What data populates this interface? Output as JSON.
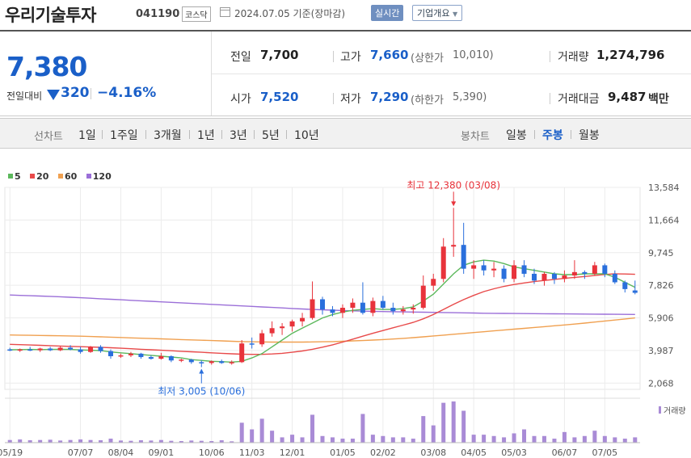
{
  "header": {
    "stock_name": "우리기술투자",
    "stock_code": "041190",
    "market": "코스닥",
    "date": "2024.07.05",
    "date_suffix": "기준(장마감)",
    "realtime_label": "실시간",
    "company_label": "기업개요"
  },
  "quote": {
    "current_price": "7,380",
    "change_label": "전일대비",
    "change_direction": "down",
    "change_value": "320",
    "change_pct": "−4.16%",
    "prev_close_label": "전일",
    "prev_close": "7,700",
    "high_label": "고가",
    "high": "7,660",
    "upper_limit_label": "(상한가",
    "upper_limit": "10,010)",
    "volume_label": "거래량",
    "volume": "1,274,796",
    "open_label": "시가",
    "open": "7,520",
    "low_label": "저가",
    "low": "7,290",
    "lower_limit_label": "(하한가",
    "lower_limit": "5,390)",
    "amount_label": "거래대금",
    "amount": "9,487",
    "amount_unit": "백만"
  },
  "period": {
    "line_label": "선차트",
    "line_items": [
      "1일",
      "1주일",
      "3개월",
      "1년",
      "3년",
      "5년",
      "10년"
    ],
    "candle_label": "봉차트",
    "candle_items": [
      "일봉",
      "주봉",
      "월봉"
    ],
    "active_candle": "주봉"
  },
  "chart_data": {
    "type": "candlestick",
    "interval": "weekly",
    "legend": [
      {
        "name": "5",
        "color": "#5cb85c"
      },
      {
        "name": "20",
        "color": "#e84a4a"
      },
      {
        "name": "60",
        "color": "#f0a050"
      },
      {
        "name": "120",
        "color": "#9b6fd8"
      }
    ],
    "y_ticks": [
      2068,
      3987,
      5906,
      7826,
      9745,
      11664,
      13584
    ],
    "y_tick_labels": [
      "2,068",
      "3,987",
      "5,906",
      "7,826",
      "9,745",
      "11,664",
      "13,584"
    ],
    "ylim": [
      1700,
      13584
    ],
    "x_labels": [
      {
        "label": "05/19",
        "index": 0
      },
      {
        "label": "07/07",
        "index": 7
      },
      {
        "label": "08/04",
        "index": 11
      },
      {
        "label": "09/01",
        "index": 15
      },
      {
        "label": "10/06",
        "index": 20
      },
      {
        "label": "11/03",
        "index": 24
      },
      {
        "label": "12/01",
        "index": 28
      },
      {
        "label": "01/05",
        "index": 33
      },
      {
        "label": "02/02",
        "index": 37
      },
      {
        "label": "03/08",
        "index": 42
      },
      {
        "label": "04/05",
        "index": 46
      },
      {
        "label": "05/03",
        "index": 50
      },
      {
        "label": "06/07",
        "index": 55
      },
      {
        "label": "07/05",
        "index": 59
      }
    ],
    "candles": [
      {
        "o": 4050,
        "h": 4150,
        "l": 3950,
        "c": 4000
      },
      {
        "o": 4000,
        "h": 4100,
        "l": 3900,
        "c": 4050
      },
      {
        "o": 4050,
        "h": 4200,
        "l": 3950,
        "c": 4000
      },
      {
        "o": 4000,
        "h": 4150,
        "l": 3900,
        "c": 4100
      },
      {
        "o": 4100,
        "h": 4200,
        "l": 3950,
        "c": 4000
      },
      {
        "o": 4000,
        "h": 4250,
        "l": 3950,
        "c": 4150
      },
      {
        "o": 4150,
        "h": 4300,
        "l": 4000,
        "c": 4050
      },
      {
        "o": 4050,
        "h": 4200,
        "l": 3800,
        "c": 3900
      },
      {
        "o": 3900,
        "h": 4250,
        "l": 3850,
        "c": 4200
      },
      {
        "o": 4200,
        "h": 4300,
        "l": 3850,
        "c": 3950
      },
      {
        "o": 3950,
        "h": 4050,
        "l": 3500,
        "c": 3650
      },
      {
        "o": 3650,
        "h": 3800,
        "l": 3550,
        "c": 3700
      },
      {
        "o": 3700,
        "h": 3900,
        "l": 3600,
        "c": 3800
      },
      {
        "o": 3800,
        "h": 3850,
        "l": 3500,
        "c": 3600
      },
      {
        "o": 3600,
        "h": 3700,
        "l": 3450,
        "c": 3500
      },
      {
        "o": 3500,
        "h": 3850,
        "l": 3450,
        "c": 3650
      },
      {
        "o": 3650,
        "h": 3700,
        "l": 3300,
        "c": 3400
      },
      {
        "o": 3400,
        "h": 3500,
        "l": 3300,
        "c": 3450
      },
      {
        "o": 3450,
        "h": 3500,
        "l": 3200,
        "c": 3300
      },
      {
        "o": 3300,
        "h": 3400,
        "l": 3005,
        "c": 3250
      },
      {
        "o": 3250,
        "h": 3400,
        "l": 3150,
        "c": 3350
      },
      {
        "o": 3350,
        "h": 3450,
        "l": 3200,
        "c": 3250
      },
      {
        "o": 3250,
        "h": 3400,
        "l": 3150,
        "c": 3300
      },
      {
        "o": 3300,
        "h": 4600,
        "l": 3250,
        "c": 4400
      },
      {
        "o": 4400,
        "h": 4750,
        "l": 4100,
        "c": 4350
      },
      {
        "o": 4350,
        "h": 5200,
        "l": 4200,
        "c": 5000
      },
      {
        "o": 5000,
        "h": 5700,
        "l": 4800,
        "c": 5300
      },
      {
        "o": 5300,
        "h": 5600,
        "l": 4900,
        "c": 5400
      },
      {
        "o": 5400,
        "h": 5800,
        "l": 5100,
        "c": 5700
      },
      {
        "o": 5700,
        "h": 6200,
        "l": 5400,
        "c": 5900
      },
      {
        "o": 5900,
        "h": 8050,
        "l": 5800,
        "c": 7000
      },
      {
        "o": 7000,
        "h": 7150,
        "l": 6100,
        "c": 6400
      },
      {
        "o": 6400,
        "h": 6600,
        "l": 6000,
        "c": 6200
      },
      {
        "o": 6200,
        "h": 6700,
        "l": 5900,
        "c": 6500
      },
      {
        "o": 6500,
        "h": 7050,
        "l": 6200,
        "c": 6800
      },
      {
        "o": 6800,
        "h": 8000,
        "l": 6100,
        "c": 6200
      },
      {
        "o": 6200,
        "h": 7100,
        "l": 6000,
        "c": 6900
      },
      {
        "o": 6900,
        "h": 7200,
        "l": 6400,
        "c": 6500
      },
      {
        "o": 6500,
        "h": 6800,
        "l": 6100,
        "c": 6300
      },
      {
        "o": 6300,
        "h": 6600,
        "l": 6100,
        "c": 6400
      },
      {
        "o": 6400,
        "h": 6700,
        "l": 6150,
        "c": 6500
      },
      {
        "o": 6500,
        "h": 8400,
        "l": 6400,
        "c": 7800
      },
      {
        "o": 7800,
        "h": 8500,
        "l": 7500,
        "c": 8200
      },
      {
        "o": 8200,
        "h": 10600,
        "l": 8000,
        "c": 10100
      },
      {
        "o": 10100,
        "h": 12380,
        "l": 9500,
        "c": 10200
      },
      {
        "o": 10200,
        "h": 11500,
        "l": 8500,
        "c": 8800
      },
      {
        "o": 8800,
        "h": 9300,
        "l": 8200,
        "c": 9000
      },
      {
        "o": 9000,
        "h": 9300,
        "l": 8400,
        "c": 8700
      },
      {
        "o": 8700,
        "h": 9200,
        "l": 8300,
        "c": 8800
      },
      {
        "o": 8800,
        "h": 9000,
        "l": 8000,
        "c": 8200
      },
      {
        "o": 8200,
        "h": 9300,
        "l": 8000,
        "c": 9000
      },
      {
        "o": 9000,
        "h": 9300,
        "l": 8300,
        "c": 8500
      },
      {
        "o": 8500,
        "h": 8800,
        "l": 7900,
        "c": 8100
      },
      {
        "o": 8100,
        "h": 8600,
        "l": 7800,
        "c": 8500
      },
      {
        "o": 8500,
        "h": 8600,
        "l": 7900,
        "c": 8200
      },
      {
        "o": 8200,
        "h": 8700,
        "l": 8000,
        "c": 8400
      },
      {
        "o": 8400,
        "h": 9300,
        "l": 8200,
        "c": 8600
      },
      {
        "o": 8600,
        "h": 8700,
        "l": 8200,
        "c": 8500
      },
      {
        "o": 8500,
        "h": 9200,
        "l": 8400,
        "c": 9000
      },
      {
        "o": 9000,
        "h": 9100,
        "l": 8300,
        "c": 8500
      },
      {
        "o": 8500,
        "h": 8700,
        "l": 7900,
        "c": 8000
      },
      {
        "o": 8000,
        "h": 8100,
        "l": 7400,
        "c": 7600
      },
      {
        "o": 7520,
        "h": 8100,
        "l": 7290,
        "c": 7380
      }
    ],
    "ma5": [
      4030,
      4040,
      4050,
      4040,
      4050,
      4060,
      4050,
      4020,
      4000,
      3980,
      3900,
      3850,
      3800,
      3750,
      3700,
      3650,
      3600,
      3550,
      3450,
      3400,
      3350,
      3330,
      3300,
      3350,
      3550,
      3800,
      4200,
      4600,
      5000,
      5300,
      5600,
      5900,
      6100,
      6250,
      6350,
      6400,
      6450,
      6400,
      6400,
      6450,
      6550,
      6900,
      7300,
      7900,
      8500,
      9000,
      9200,
      9300,
      9250,
      9100,
      8900,
      8800,
      8700,
      8600,
      8500,
      8450,
      8450,
      8500,
      8500,
      8500,
      8300,
      8000,
      7700
    ],
    "ma20": [
      4350,
      4330,
      4310,
      4290,
      4270,
      4250,
      4230,
      4210,
      4190,
      4170,
      4150,
      4120,
      4090,
      4060,
      4030,
      4000,
      3970,
      3940,
      3910,
      3880,
      3850,
      3820,
      3790,
      3770,
      3760,
      3760,
      3780,
      3820,
      3880,
      3960,
      4060,
      4180,
      4320,
      4480,
      4650,
      4830,
      5000,
      5160,
      5320,
      5480,
      5640,
      5850,
      6100,
      6400,
      6700,
      6980,
      7230,
      7450,
      7620,
      7760,
      7870,
      7960,
      8040,
      8110,
      8170,
      8230,
      8290,
      8340,
      8400,
      8460,
      8500,
      8490,
      8470
    ],
    "ma60": [
      4900,
      4890,
      4880,
      4870,
      4860,
      4850,
      4840,
      4830,
      4810,
      4790,
      4770,
      4750,
      4730,
      4710,
      4690,
      4670,
      4650,
      4630,
      4610,
      4590,
      4570,
      4550,
      4530,
      4510,
      4500,
      4490,
      4480,
      4480,
      4480,
      4480,
      4490,
      4500,
      4510,
      4530,
      4550,
      4570,
      4600,
      4630,
      4660,
      4700,
      4740,
      4790,
      4840,
      4890,
      4940,
      4990,
      5040,
      5090,
      5140,
      5190,
      5240,
      5290,
      5340,
      5390,
      5440,
      5490,
      5540,
      5600,
      5660,
      5720,
      5780,
      5840,
      5900
    ],
    "ma120": [
      7250,
      7230,
      7210,
      7190,
      7170,
      7150,
      7120,
      7090,
      7060,
      7030,
      7000,
      6970,
      6940,
      6910,
      6880,
      6850,
      6820,
      6790,
      6760,
      6730,
      6700,
      6670,
      6640,
      6610,
      6580,
      6550,
      6520,
      6490,
      6460,
      6430,
      6400,
      6380,
      6360,
      6340,
      6320,
      6300,
      6290,
      6280,
      6270,
      6260,
      6250,
      6240,
      6230,
      6220,
      6210,
      6200,
      6190,
      6180,
      6175,
      6170,
      6165,
      6160,
      6155,
      6150,
      6145,
      6140,
      6135,
      6130,
      6125,
      6120,
      6115,
      6110,
      6105
    ],
    "volume": [
      1.0,
      1.2,
      0.9,
      1.0,
      1.1,
      0.8,
      1.0,
      1.2,
      1.0,
      0.9,
      1.5,
      0.8,
      0.7,
      0.9,
      0.8,
      1.0,
      0.7,
      0.6,
      0.8,
      0.7,
      0.6,
      0.9,
      0.5,
      7.5,
      5.0,
      9.0,
      4.5,
      2.0,
      3.0,
      2.0,
      10.5,
      2.5,
      2.0,
      1.5,
      1.5,
      10.8,
      3.0,
      2.5,
      2.0,
      2.0,
      1.5,
      10.0,
      6.5,
      15.0,
      15.5,
      12.0,
      3.0,
      3.0,
      2.5,
      2.0,
      3.5,
      5.0,
      2.5,
      2.5,
      1.5,
      4.0,
      2.0,
      2.5,
      4.5,
      2.5,
      2.0,
      1.5,
      2.0
    ],
    "high_annotation": {
      "label": "최고 12,380 (03/08)",
      "index": 44,
      "value": 12380
    },
    "low_annotation": {
      "label": "최저 3,005 (10/06)",
      "index": 19,
      "value": 3005
    },
    "volume_label": "거래량",
    "up_color": "#e8333b",
    "down_color": "#2a6fdc",
    "volume_color": "#a98bd6"
  }
}
